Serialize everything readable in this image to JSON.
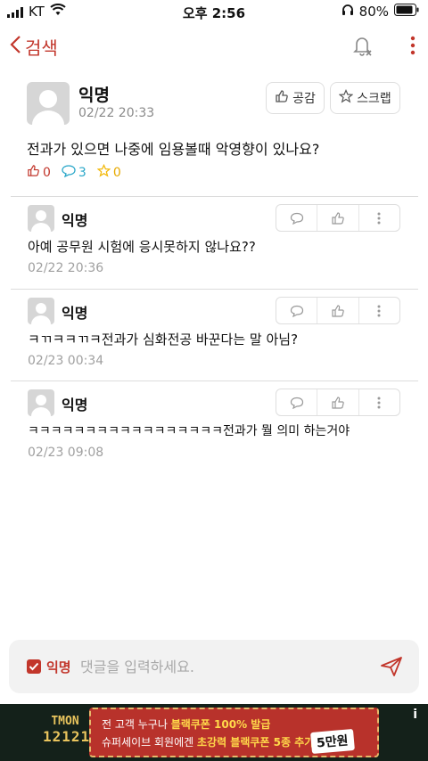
{
  "status_bar": {
    "carrier": "KT",
    "time": "오후 2:56",
    "battery": "80%"
  },
  "header": {
    "back_label": "검색"
  },
  "post": {
    "author": "익명",
    "date": "02/22 20:33",
    "like_button": "공감",
    "scrap_button": "스크랩",
    "body": "전과가 있으면 나중에 임용볼때 악영향이 있나요?",
    "likes": "0",
    "comments": "3",
    "scraps": "0"
  },
  "comments": [
    {
      "author": "익명",
      "text": "아예 공무원 시험에 응시못하지 않나요??",
      "date": "02/22 20:36"
    },
    {
      "author": "익명",
      "text": "ㅋㄲㅋㅋㄲㅋ전과가 심화전공 바꾼다는 말 아님?",
      "date": "02/23 00:34"
    },
    {
      "author": "익명",
      "text": "ㅋㅋㅋㅋㅋㅋㅋㅋㅋㅋㅋㅋㅋㅋㅋㅋㅋ전과가 뭘 의미 하는거야",
      "date": "02/23 09:08"
    }
  ],
  "composer": {
    "anonymous_label": "익명",
    "placeholder": "댓글을 입력하세요."
  },
  "ad": {
    "logo_line1": "TMON",
    "logo_line2": "121212",
    "line1_prefix": "전 고객 누구나 ",
    "line1_highlight": "블랙쿠폰 100% 발급",
    "line2_prefix": "슈퍼세이브 회원에겐 ",
    "line2_highlight": "초강력 블랙쿠폰 5종 추가!",
    "badge": "5만원",
    "info": "i"
  },
  "colors": {
    "accent": "#c2362b",
    "like": "#c2362b",
    "comment": "#2aa7c9",
    "scrap": "#f2b705"
  }
}
